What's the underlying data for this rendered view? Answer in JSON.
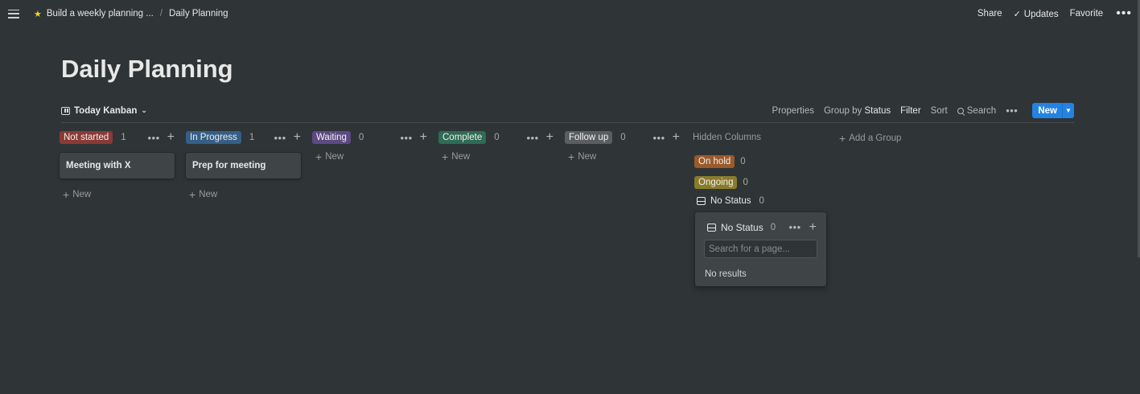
{
  "topbar": {
    "breadcrumb": [
      "Build a weekly planning ...",
      "Daily Planning"
    ],
    "separator": "/",
    "share": "Share",
    "updates": "Updates",
    "favorite": "Favorite"
  },
  "page": {
    "title": "Daily Planning"
  },
  "viewbar": {
    "view_name": "Today Kanban",
    "properties": "Properties",
    "group_by": "Group by",
    "group_by_value": "Status",
    "filter": "Filter",
    "sort": "Sort",
    "search": "Search",
    "new": "New"
  },
  "columns": [
    {
      "label": "Not started",
      "count": "1",
      "color": "#8a3a35",
      "cards": [
        "Meeting with X"
      ],
      "new_label": "New"
    },
    {
      "label": "In Progress",
      "count": "1",
      "color": "#355f86",
      "cards": [
        "Prep for meeting"
      ],
      "new_label": "New"
    },
    {
      "label": "Waiting",
      "count": "0",
      "color": "#5d4a82",
      "cards": [],
      "new_label": "New"
    },
    {
      "label": "Complete",
      "count": "0",
      "color": "#2f6b55",
      "cards": [],
      "new_label": "New"
    },
    {
      "label": "Follow up",
      "count": "0",
      "color": "#5a5e60",
      "cards": [],
      "new_label": "New"
    }
  ],
  "hidden": {
    "title": "Hidden Columns",
    "groups": [
      {
        "label": "On hold",
        "count": "0",
        "color": "#9b5a2a"
      },
      {
        "label": "Ongoing",
        "count": "0",
        "color": "#8a7b2c"
      },
      {
        "label": "No Status",
        "count": "0",
        "icon": "inbox-icon"
      }
    ]
  },
  "add_group": "Add a Group",
  "popup": {
    "title": "No Status",
    "count": "0",
    "search_placeholder": "Search for a page...",
    "no_results": "No results"
  }
}
